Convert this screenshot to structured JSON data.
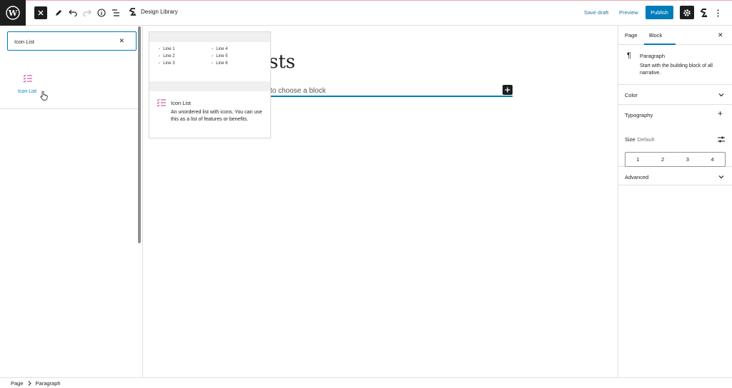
{
  "topbar": {
    "title": "Design Library",
    "save_draft": "Save draft",
    "preview": "Preview",
    "publish": "Publish"
  },
  "inserter": {
    "search_value": "Icon List",
    "result_label": "Icon List"
  },
  "preview_panel": {
    "lines_left": [
      "Line 1",
      "Line 2",
      "Line 3"
    ],
    "lines_right": [
      "Line 4",
      "Line 5",
      "Line 6"
    ],
    "block_title": "Icon List",
    "block_description": "An unordered list with icons. You can use this as a list of features or benefits."
  },
  "editor": {
    "title_fragment": "sts",
    "placeholder": "to choose a block"
  },
  "sidebar": {
    "tab_page": "Page",
    "tab_block": "Block",
    "block_name": "Paragraph",
    "block_description": "Start with the building block of all narrative.",
    "panel_color": "Color",
    "panel_typography": "Typography",
    "size_label": "Size",
    "size_default": "Default",
    "size_options": [
      "1",
      "2",
      "3",
      "4"
    ],
    "panel_advanced": "Advanced"
  },
  "statusbar": {
    "crumb_1": "Page",
    "crumb_2": "Paragraph"
  },
  "colors": {
    "accent": "#007cba",
    "dark": "#1e1e1e",
    "icon_list_pink": "#c0378a"
  }
}
